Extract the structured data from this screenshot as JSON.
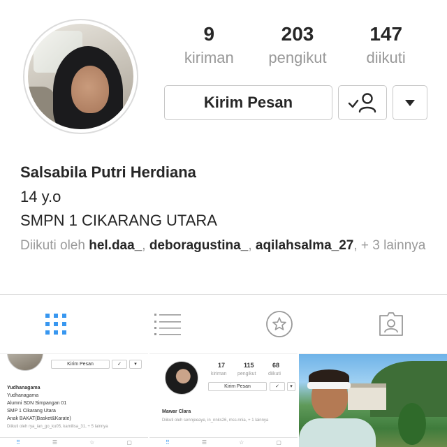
{
  "profile": {
    "stats": [
      {
        "value": "9",
        "label": "kiriman"
      },
      {
        "value": "203",
        "label": "pengikut"
      },
      {
        "value": "147",
        "label": "diikuti"
      }
    ],
    "message_button": "Kirim Pesan",
    "name": "Salsabila Putri Herdiana",
    "bio_lines": [
      "14 y.o",
      "SMPN 1 CIKARANG UTARA"
    ],
    "followed_by": {
      "prefix": "Diikuti oleh",
      "users": [
        "hel.daa_",
        "deboragustina_",
        "aqilahsalma_27"
      ],
      "suffix": "+ 3 lainnya"
    }
  },
  "tabs": [
    "grid-view",
    "list-view",
    "saved",
    "tagged"
  ],
  "grid": [
    {
      "message_button": "Kirim Pesan",
      "lines": [
        "Yudhanagama",
        "Yudhanagama",
        "Alumni SDN Simpangan 01",
        "SMP 1 Cikarang Utara",
        "Anak BAKAT(Basket&Karate)"
      ],
      "followed": "Diikuti oleh rya_ian_go_ku05, kamilisa_31, + 5 lainnya"
    },
    {
      "stats": [
        {
          "value": "17",
          "label": "kiriman"
        },
        {
          "value": "115",
          "label": "pengikut"
        },
        {
          "value": "68",
          "label": "diikuti"
        }
      ],
      "message_button": "Kirim Pesan",
      "name": "Mawar Clara",
      "followed": "Diikuti oleh sennjeeaye, in_nnks26, mss.nnia, + 1 lainnya"
    },
    {
      "type": "photo"
    }
  ],
  "colors": {
    "text": "#262626",
    "muted": "#999999",
    "border": "#c7c7c7",
    "active_tab": "#3897f0"
  }
}
